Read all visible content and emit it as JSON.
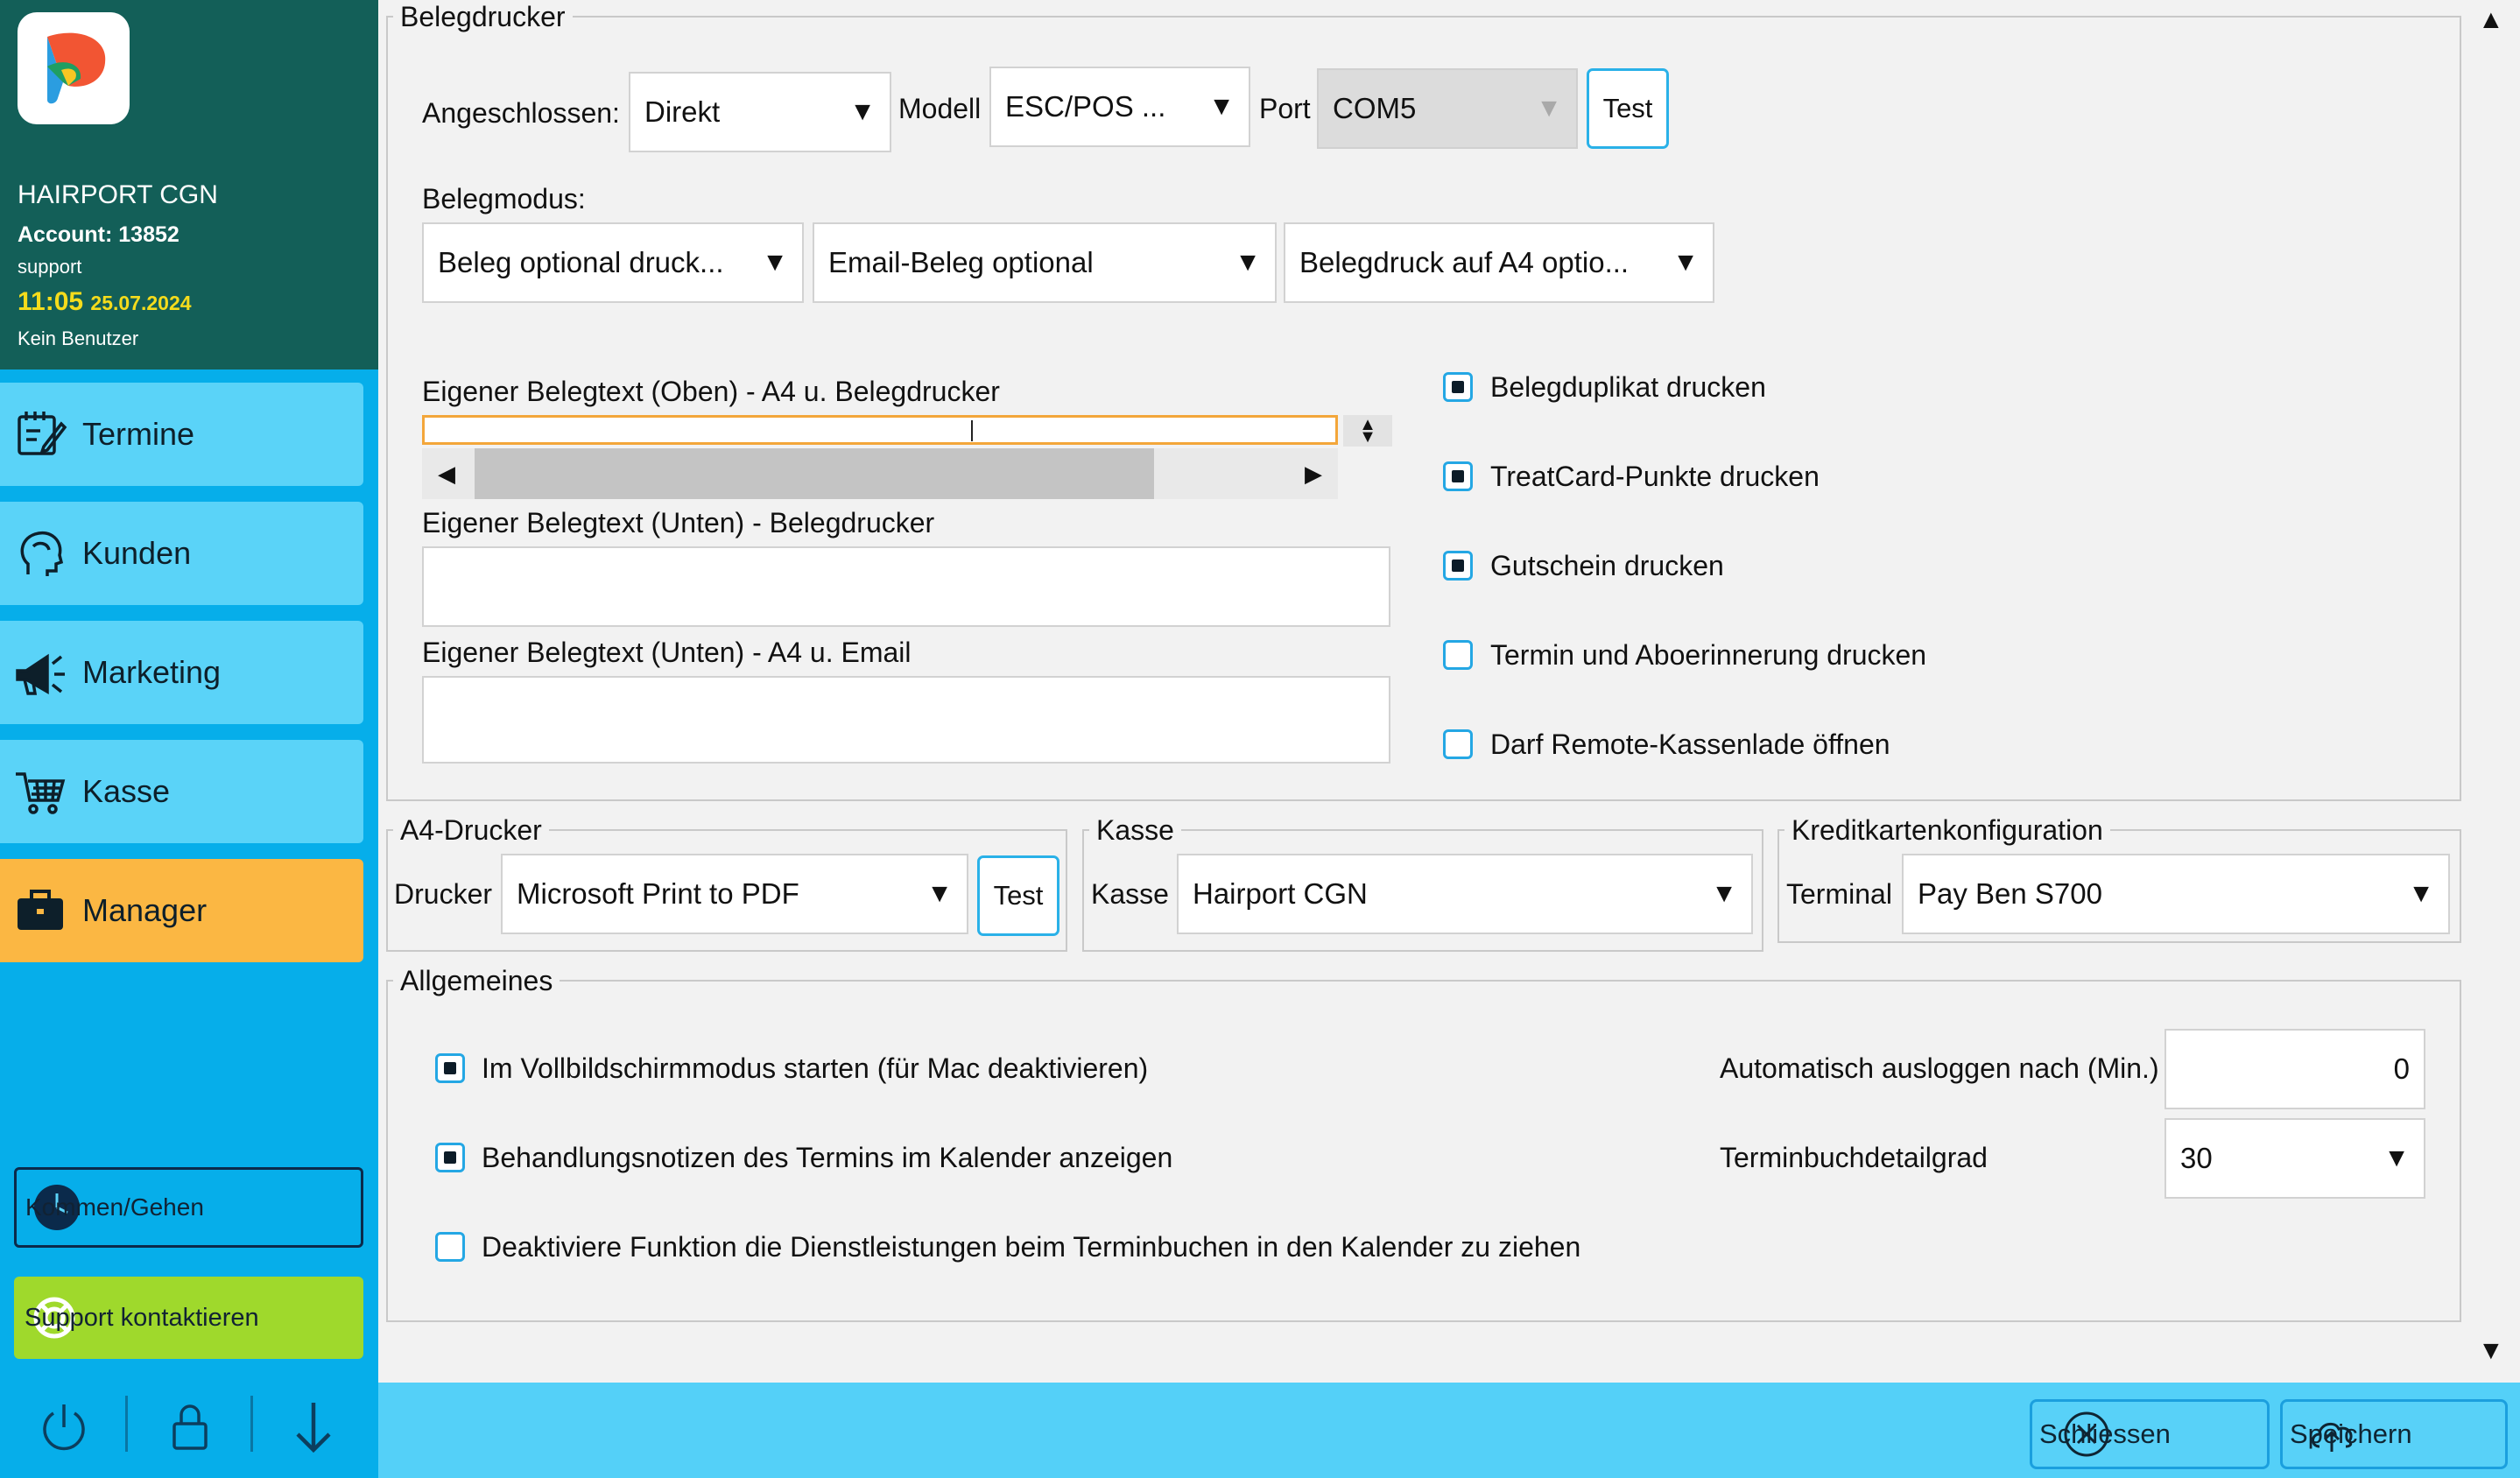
{
  "sidebar": {
    "salon": "HAIRPORT CGN",
    "account": "Account: 13852",
    "role": "support",
    "time": "11:05",
    "date": "25.07.2024",
    "user": "Kein Benutzer",
    "nav": [
      {
        "label": "Termine",
        "icon": "calendar-edit-icon"
      },
      {
        "label": "Kunden",
        "icon": "head-icon"
      },
      {
        "label": "Marketing",
        "icon": "megaphone-icon"
      },
      {
        "label": "Kasse",
        "icon": "cart-icon"
      },
      {
        "label": "Manager",
        "icon": "briefcase-icon"
      }
    ],
    "kommen_gehen": "Kommen/Gehen",
    "support": "Support kontaktieren",
    "colors": {
      "header": "#135f58",
      "nav": "#5ad3f8",
      "active": "#fbb743",
      "support": "#9fd92c",
      "time": "#f5dc1c"
    }
  },
  "belegdrucker": {
    "legend": "Belegdrucker",
    "angeschlossen_label": "Angeschlossen:",
    "angeschlossen_value": "Direkt",
    "modell_label": "Modell",
    "modell_value": "ESC/POS ...",
    "port_label": "Port",
    "port_value": "COM5",
    "test_label": "Test",
    "belegmodus_label": "Belegmodus:",
    "mode1": "Beleg optional druck...",
    "mode2": "Email-Beleg optional",
    "mode3": "Belegdruck auf A4 optio...",
    "text_oben_label": "Eigener Belegtext (Oben) - A4 u. Belegdrucker",
    "text_unten_beleg_label": "Eigener Belegtext (Unten) - Belegdrucker",
    "text_unten_a4_label": "Eigener Belegtext (Unten) - A4 u. Email",
    "options": [
      {
        "label": "Belegduplikat drucken",
        "checked": true
      },
      {
        "label": "TreatCard-Punkte drucken",
        "checked": true
      },
      {
        "label": "Gutschein drucken",
        "checked": true
      },
      {
        "label": "Termin und Aboerinnerung drucken",
        "checked": false
      },
      {
        "label": "Darf Remote-Kassenlade öffnen",
        "checked": false
      }
    ]
  },
  "a4": {
    "legend": "A4-Drucker",
    "drucker_label": "Drucker",
    "drucker_value": "Microsoft Print to PDF",
    "test_label": "Test"
  },
  "kasse": {
    "legend": "Kasse",
    "kasse_label": "Kasse",
    "kasse_value": "Hairport CGN"
  },
  "kreditkarte": {
    "legend": "Kreditkartenkonfiguration",
    "terminal_label": "Terminal",
    "terminal_value": "Pay Ben S700"
  },
  "allgemeines": {
    "legend": "Allgemeines",
    "options": [
      {
        "label": "Im Vollbildschirmmodus starten (für Mac deaktivieren)",
        "checked": true
      },
      {
        "label": "Behandlungsnotizen des Termins im Kalender anzeigen",
        "checked": true
      },
      {
        "label": "Deaktiviere Funktion die Dienstleistungen beim Terminbuchen in den Kalender zu ziehen",
        "checked": false
      }
    ],
    "logout_label": "Automatisch ausloggen nach (Min.)",
    "logout_value": "0",
    "detailgrad_label": "Terminbuchdetailgrad",
    "detailgrad_value": "30"
  },
  "footer": {
    "close": "Schliessen",
    "save": "Speichern"
  }
}
